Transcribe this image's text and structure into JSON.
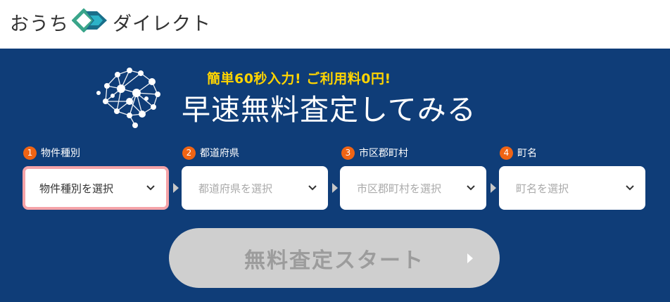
{
  "header": {
    "logo_left": "おうち",
    "logo_right": "ダイレクト",
    "logo_icon": "house-diamond-logo-icon",
    "brand_colors": {
      "green": "#3aa58a",
      "teal": "#1a6f8a",
      "cyan": "#2cb3c8"
    }
  },
  "hero": {
    "catchcopy": "簡単60秒入力!  ご利用料0円!",
    "title": "早速無料査定してみる",
    "brain_icon": "brain-network-icon"
  },
  "steps": [
    {
      "number": "1",
      "label": "物件種別",
      "placeholder": "物件種別を選択",
      "active": true
    },
    {
      "number": "2",
      "label": "都道府県",
      "placeholder": "都道府県を選択",
      "active": false
    },
    {
      "number": "3",
      "label": "市区郡町村",
      "placeholder": "市区郡町村を選択",
      "active": false
    },
    {
      "number": "4",
      "label": "町名",
      "placeholder": "町名を選択",
      "active": false
    }
  ],
  "start_button": {
    "label": "無料査定スタート",
    "enabled": false
  },
  "colors": {
    "panel_bg": "#0f3d78",
    "catch_yellow": "#ffd400",
    "badge_orange": "#f06414",
    "active_border": "#f5a3a8",
    "disabled_button": "#cfcfcf"
  }
}
